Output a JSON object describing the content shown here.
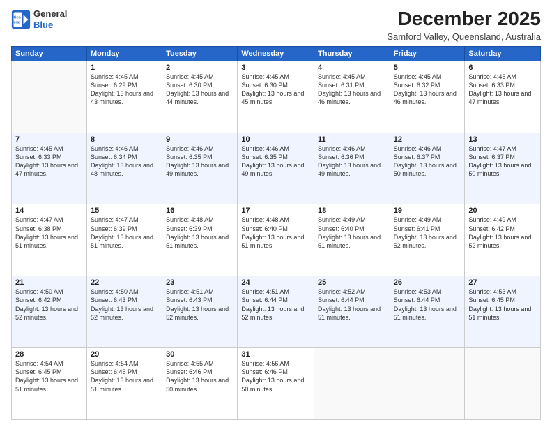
{
  "header": {
    "logo_line1": "General",
    "logo_line2": "Blue",
    "month": "December 2025",
    "location": "Samford Valley, Queensland, Australia"
  },
  "days_of_week": [
    "Sunday",
    "Monday",
    "Tuesday",
    "Wednesday",
    "Thursday",
    "Friday",
    "Saturday"
  ],
  "weeks": [
    [
      {
        "date": "",
        "sunrise": "",
        "sunset": "",
        "daylight": ""
      },
      {
        "date": "1",
        "sunrise": "Sunrise: 4:45 AM",
        "sunset": "Sunset: 6:29 PM",
        "daylight": "Daylight: 13 hours and 43 minutes."
      },
      {
        "date": "2",
        "sunrise": "Sunrise: 4:45 AM",
        "sunset": "Sunset: 6:30 PM",
        "daylight": "Daylight: 13 hours and 44 minutes."
      },
      {
        "date": "3",
        "sunrise": "Sunrise: 4:45 AM",
        "sunset": "Sunset: 6:30 PM",
        "daylight": "Daylight: 13 hours and 45 minutes."
      },
      {
        "date": "4",
        "sunrise": "Sunrise: 4:45 AM",
        "sunset": "Sunset: 6:31 PM",
        "daylight": "Daylight: 13 hours and 46 minutes."
      },
      {
        "date": "5",
        "sunrise": "Sunrise: 4:45 AM",
        "sunset": "Sunset: 6:32 PM",
        "daylight": "Daylight: 13 hours and 46 minutes."
      },
      {
        "date": "6",
        "sunrise": "Sunrise: 4:45 AM",
        "sunset": "Sunset: 6:33 PM",
        "daylight": "Daylight: 13 hours and 47 minutes."
      }
    ],
    [
      {
        "date": "7",
        "sunrise": "Sunrise: 4:45 AM",
        "sunset": "Sunset: 6:33 PM",
        "daylight": "Daylight: 13 hours and 47 minutes."
      },
      {
        "date": "8",
        "sunrise": "Sunrise: 4:46 AM",
        "sunset": "Sunset: 6:34 PM",
        "daylight": "Daylight: 13 hours and 48 minutes."
      },
      {
        "date": "9",
        "sunrise": "Sunrise: 4:46 AM",
        "sunset": "Sunset: 6:35 PM",
        "daylight": "Daylight: 13 hours and 49 minutes."
      },
      {
        "date": "10",
        "sunrise": "Sunrise: 4:46 AM",
        "sunset": "Sunset: 6:35 PM",
        "daylight": "Daylight: 13 hours and 49 minutes."
      },
      {
        "date": "11",
        "sunrise": "Sunrise: 4:46 AM",
        "sunset": "Sunset: 6:36 PM",
        "daylight": "Daylight: 13 hours and 49 minutes."
      },
      {
        "date": "12",
        "sunrise": "Sunrise: 4:46 AM",
        "sunset": "Sunset: 6:37 PM",
        "daylight": "Daylight: 13 hours and 50 minutes."
      },
      {
        "date": "13",
        "sunrise": "Sunrise: 4:47 AM",
        "sunset": "Sunset: 6:37 PM",
        "daylight": "Daylight: 13 hours and 50 minutes."
      }
    ],
    [
      {
        "date": "14",
        "sunrise": "Sunrise: 4:47 AM",
        "sunset": "Sunset: 6:38 PM",
        "daylight": "Daylight: 13 hours and 51 minutes."
      },
      {
        "date": "15",
        "sunrise": "Sunrise: 4:47 AM",
        "sunset": "Sunset: 6:39 PM",
        "daylight": "Daylight: 13 hours and 51 minutes."
      },
      {
        "date": "16",
        "sunrise": "Sunrise: 4:48 AM",
        "sunset": "Sunset: 6:39 PM",
        "daylight": "Daylight: 13 hours and 51 minutes."
      },
      {
        "date": "17",
        "sunrise": "Sunrise: 4:48 AM",
        "sunset": "Sunset: 6:40 PM",
        "daylight": "Daylight: 13 hours and 51 minutes."
      },
      {
        "date": "18",
        "sunrise": "Sunrise: 4:49 AM",
        "sunset": "Sunset: 6:40 PM",
        "daylight": "Daylight: 13 hours and 51 minutes."
      },
      {
        "date": "19",
        "sunrise": "Sunrise: 4:49 AM",
        "sunset": "Sunset: 6:41 PM",
        "daylight": "Daylight: 13 hours and 52 minutes."
      },
      {
        "date": "20",
        "sunrise": "Sunrise: 4:49 AM",
        "sunset": "Sunset: 6:42 PM",
        "daylight": "Daylight: 13 hours and 52 minutes."
      }
    ],
    [
      {
        "date": "21",
        "sunrise": "Sunrise: 4:50 AM",
        "sunset": "Sunset: 6:42 PM",
        "daylight": "Daylight: 13 hours and 52 minutes."
      },
      {
        "date": "22",
        "sunrise": "Sunrise: 4:50 AM",
        "sunset": "Sunset: 6:43 PM",
        "daylight": "Daylight: 13 hours and 52 minutes."
      },
      {
        "date": "23",
        "sunrise": "Sunrise: 4:51 AM",
        "sunset": "Sunset: 6:43 PM",
        "daylight": "Daylight: 13 hours and 52 minutes."
      },
      {
        "date": "24",
        "sunrise": "Sunrise: 4:51 AM",
        "sunset": "Sunset: 6:44 PM",
        "daylight": "Daylight: 13 hours and 52 minutes."
      },
      {
        "date": "25",
        "sunrise": "Sunrise: 4:52 AM",
        "sunset": "Sunset: 6:44 PM",
        "daylight": "Daylight: 13 hours and 51 minutes."
      },
      {
        "date": "26",
        "sunrise": "Sunrise: 4:53 AM",
        "sunset": "Sunset: 6:44 PM",
        "daylight": "Daylight: 13 hours and 51 minutes."
      },
      {
        "date": "27",
        "sunrise": "Sunrise: 4:53 AM",
        "sunset": "Sunset: 6:45 PM",
        "daylight": "Daylight: 13 hours and 51 minutes."
      }
    ],
    [
      {
        "date": "28",
        "sunrise": "Sunrise: 4:54 AM",
        "sunset": "Sunset: 6:45 PM",
        "daylight": "Daylight: 13 hours and 51 minutes."
      },
      {
        "date": "29",
        "sunrise": "Sunrise: 4:54 AM",
        "sunset": "Sunset: 6:45 PM",
        "daylight": "Daylight: 13 hours and 51 minutes."
      },
      {
        "date": "30",
        "sunrise": "Sunrise: 4:55 AM",
        "sunset": "Sunset: 6:46 PM",
        "daylight": "Daylight: 13 hours and 50 minutes."
      },
      {
        "date": "31",
        "sunrise": "Sunrise: 4:56 AM",
        "sunset": "Sunset: 6:46 PM",
        "daylight": "Daylight: 13 hours and 50 minutes."
      },
      {
        "date": "",
        "sunrise": "",
        "sunset": "",
        "daylight": ""
      },
      {
        "date": "",
        "sunrise": "",
        "sunset": "",
        "daylight": ""
      },
      {
        "date": "",
        "sunrise": "",
        "sunset": "",
        "daylight": ""
      }
    ]
  ]
}
